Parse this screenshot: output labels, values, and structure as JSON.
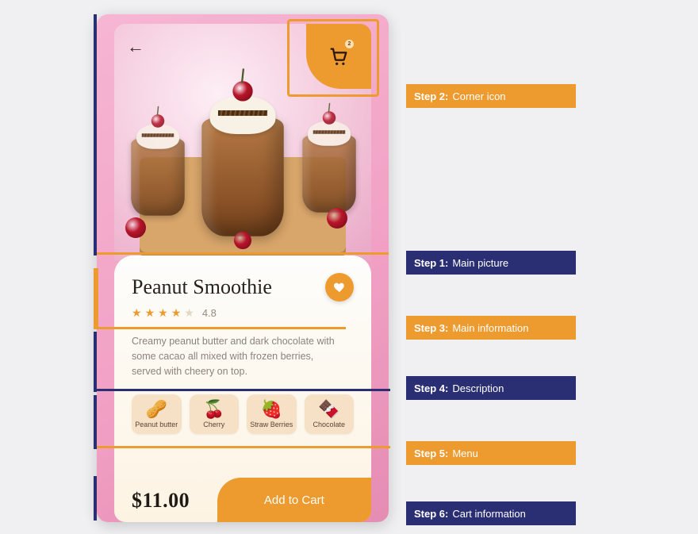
{
  "product": {
    "title": "Peanut Smoothie",
    "rating": "4.8",
    "description": "Creamy peanut butter and dark chocolate with some cacao all mixed with frozen berries, served with cheery on top.",
    "price": "$11.00",
    "add_to_cart_label": "Add to Cart",
    "cart_badge_count": "2"
  },
  "ingredients": [
    {
      "label": "Peanut butter",
      "glyph": "🥜"
    },
    {
      "label": "Cherry",
      "glyph": "🍒"
    },
    {
      "label": "Straw Berries",
      "glyph": "🍓"
    },
    {
      "label": "Chocolate",
      "glyph": "🍫"
    }
  ],
  "steps": {
    "s1": {
      "prefix": "Step 1:",
      "text": "Main picture"
    },
    "s2": {
      "prefix": "Step 2:",
      "text": "Corner icon"
    },
    "s3": {
      "prefix": "Step 3:",
      "text": "Main information"
    },
    "s4": {
      "prefix": "Step 4:",
      "text": "Description"
    },
    "s5": {
      "prefix": "Step 5:",
      "text": "Menu"
    },
    "s6": {
      "prefix": "Step 6:",
      "text": "Cart information"
    }
  },
  "colors": {
    "orange": "#ed9a2e",
    "navy": "#2a2f73"
  }
}
